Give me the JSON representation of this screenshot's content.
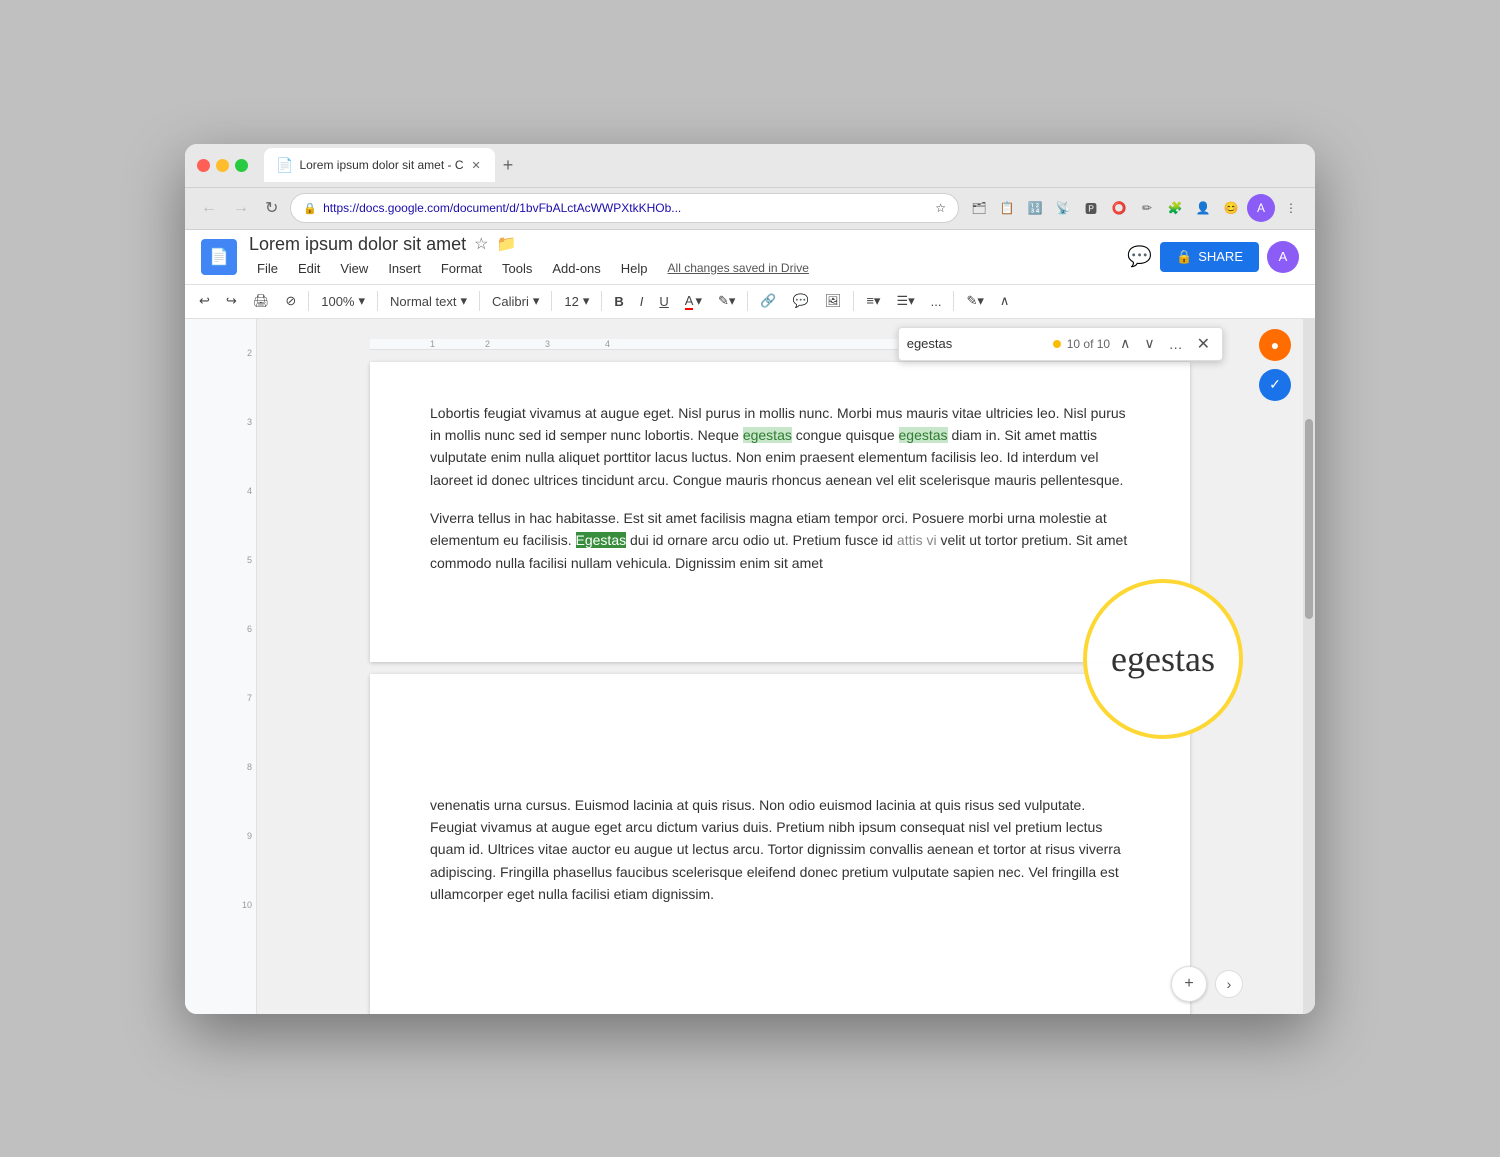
{
  "browser": {
    "tab_title": "Lorem ipsum dolor sit amet - C",
    "url": "https://docs.google.com/document/d/1bvFbALctAcWWPXtkKHOb...",
    "new_tab_label": "+"
  },
  "docs": {
    "title": "Lorem ipsum dolor sit amet",
    "menu": {
      "file": "File",
      "edit": "Edit",
      "view": "View",
      "insert": "Insert",
      "format": "Format",
      "tools": "Tools",
      "addons": "Add-ons",
      "help": "Help",
      "saved": "All changes saved in Drive"
    },
    "toolbar": {
      "undo": "↩",
      "redo": "↪",
      "print": "🖨",
      "paintformat": "⊘",
      "zoom": "100%",
      "style": "Normal text",
      "font": "Calibri",
      "size": "12",
      "bold": "B",
      "italic": "I",
      "underline": "U",
      "fontcolor": "A",
      "highlight": "✎",
      "link": "🔗",
      "comment": "💬",
      "image": "🖼",
      "align": "≡",
      "list": "☰",
      "more": "...",
      "paint": "✎",
      "expand": "∧"
    },
    "share_label": "SHARE",
    "find": {
      "placeholder": "egestas",
      "value": "egestas",
      "count": "10 of 10",
      "zoom_word": "egestas"
    }
  },
  "document": {
    "page1_text": "Lobortis feugiat vivamus at augue eget. Nisl purus in mollis nunc. Morbi mus mauris vitae ultricies leo. Nisl purus in mollis nunc sed id semper nunc lobortis. Neque egestas congue quisque egestas diam in. Sit amet mattis vulputate enim nulla aliquet porttitor lacus luctus. Non enim praesent elementum facilisis leo. Id interdum vel laoreet id donec ultrices tincidunt arcu. Congue mauris rhoncus aenean vel elit scelerisque mauris pellentesque.",
    "page1_para2": "Viverra tellus in hac habitasse. Est sit amet facilisis magna etiam tempor orci. Posuere morbi urna molestie at elementum eu facilisis. Egestas dui id ornare arcu odio ut. Pretium fusce id attis vi velit ut tortor pretium. Sit amet commodo nulla facilisi nullam vehicula. Dignissim enim sit amet",
    "page2_text": "venenatis urna cursus. Euismod lacinia at quis risus. Non odio euismod lacinia at quis risus sed vulputate. Feugiat vivamus at augue eget arcu dictum varius duis. Pretium nibh ipsum consequat nisl vel pretium lectus quam id. Ultrices vitae auctor eu augue ut lectus arcu. Tortor dignissim convallis aenean et tortor at risus viverra adipiscing. Fringilla phasellus faucibus scelerisque eleifend donec pretium vulputate sapien nec. Vel fringilla est ullamcorper eget nulla facilisi etiam dignissim."
  },
  "ruler": {
    "marks": [
      "1",
      "2",
      "3",
      "4"
    ],
    "left_marks": [
      "2",
      "3",
      "4",
      "5",
      "6",
      "7",
      "8",
      "9",
      "10"
    ]
  }
}
